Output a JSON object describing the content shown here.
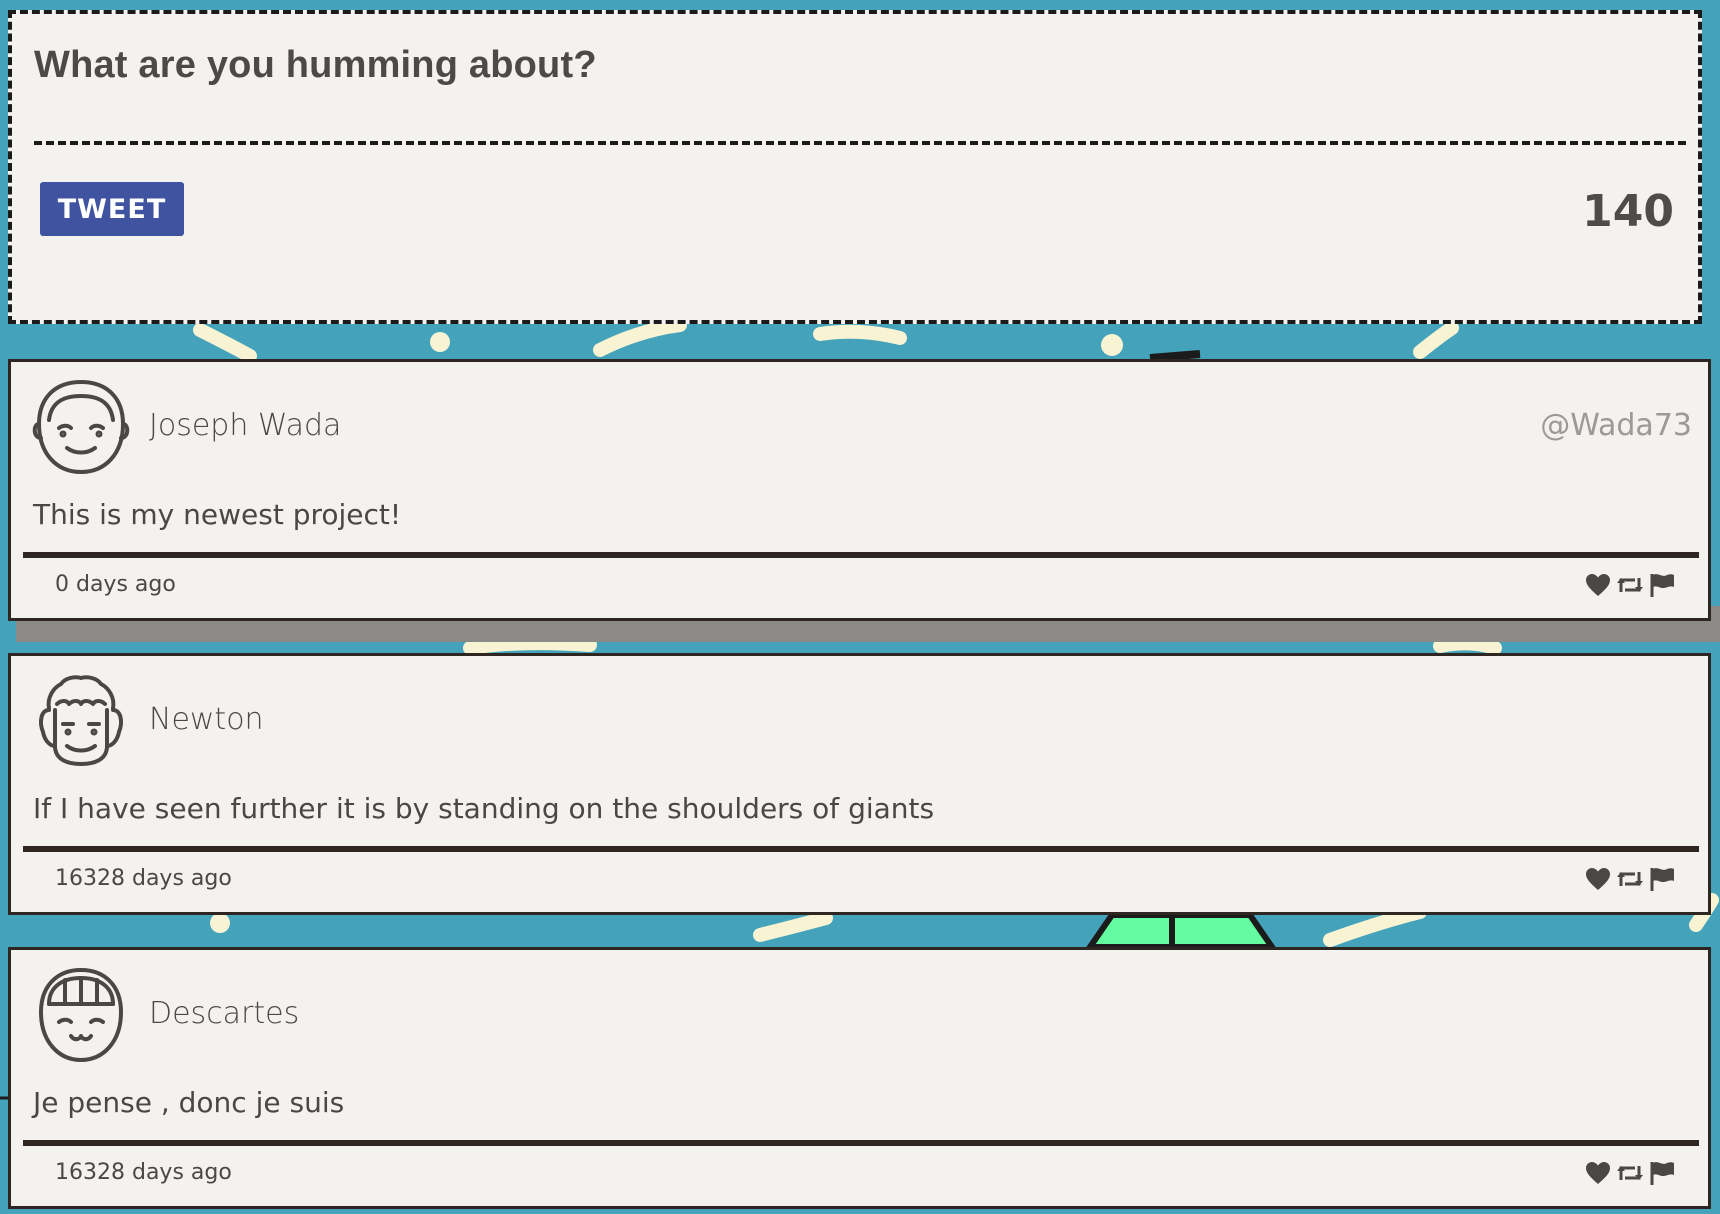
{
  "compose": {
    "prompt": "What are you humming about?",
    "tweet_button": "TWEET",
    "char_count": "140"
  },
  "tweets": [
    {
      "avatar_icon": "smiling-boy-avatar-icon",
      "author": "Joseph Wada",
      "handle": "@Wada73",
      "text": "This is my newest project!",
      "time": "0 days ago"
    },
    {
      "avatar_icon": "curly-hair-avatar-icon",
      "author": "Newton",
      "handle": "",
      "text": "If I have seen further it is by standing on the shoulders of giants",
      "time": "16328 days ago"
    },
    {
      "avatar_icon": "bangs-hair-avatar-icon",
      "author": "Descartes",
      "handle": "",
      "text": "Je pense , donc je suis",
      "time": "16328 days ago"
    }
  ],
  "colors": {
    "background": "#44a3bb",
    "card": "#f4f2ee",
    "button": "#4053a0",
    "border": "#2e2620"
  }
}
